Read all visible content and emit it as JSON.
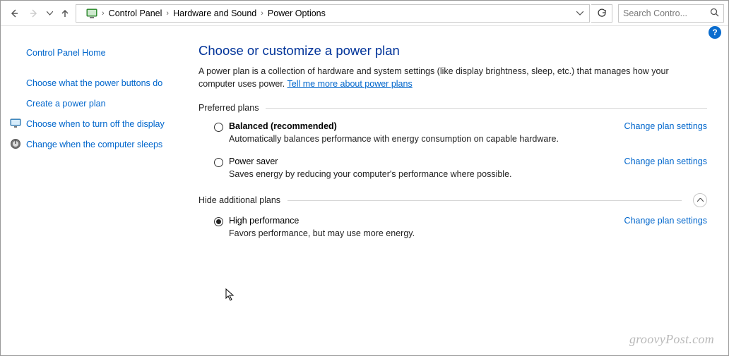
{
  "toolbar": {
    "breadcrumbs": [
      "Control Panel",
      "Hardware and Sound",
      "Power Options"
    ],
    "search_placeholder": "Search Contro..."
  },
  "sidebar": {
    "home_label": "Control Panel Home",
    "links": [
      {
        "label": "Choose what the power buttons do"
      },
      {
        "label": "Create a power plan"
      },
      {
        "label": "Choose when to turn off the display",
        "icon": "monitor"
      },
      {
        "label": "Change when the computer sleeps",
        "icon": "power"
      }
    ]
  },
  "main": {
    "title": "Choose or customize a power plan",
    "description_pre": "A power plan is a collection of hardware and system settings (like display brightness, sleep, etc.) that manages how your computer uses power. ",
    "description_link": "Tell me more about power plans",
    "preferred_header": "Preferred plans",
    "additional_header": "Hide additional plans",
    "change_link": "Change plan settings",
    "plans_preferred": [
      {
        "name": "Balanced (recommended)",
        "desc": "Automatically balances performance with energy consumption on capable hardware.",
        "selected": false,
        "bold": true
      },
      {
        "name": "Power saver",
        "desc": "Saves energy by reducing your computer's performance where possible.",
        "selected": false,
        "bold": false
      }
    ],
    "plans_additional": [
      {
        "name": "High performance",
        "desc": "Favors performance, but may use more energy.",
        "selected": true,
        "bold": false
      }
    ]
  },
  "watermark": "groovyPost.com"
}
